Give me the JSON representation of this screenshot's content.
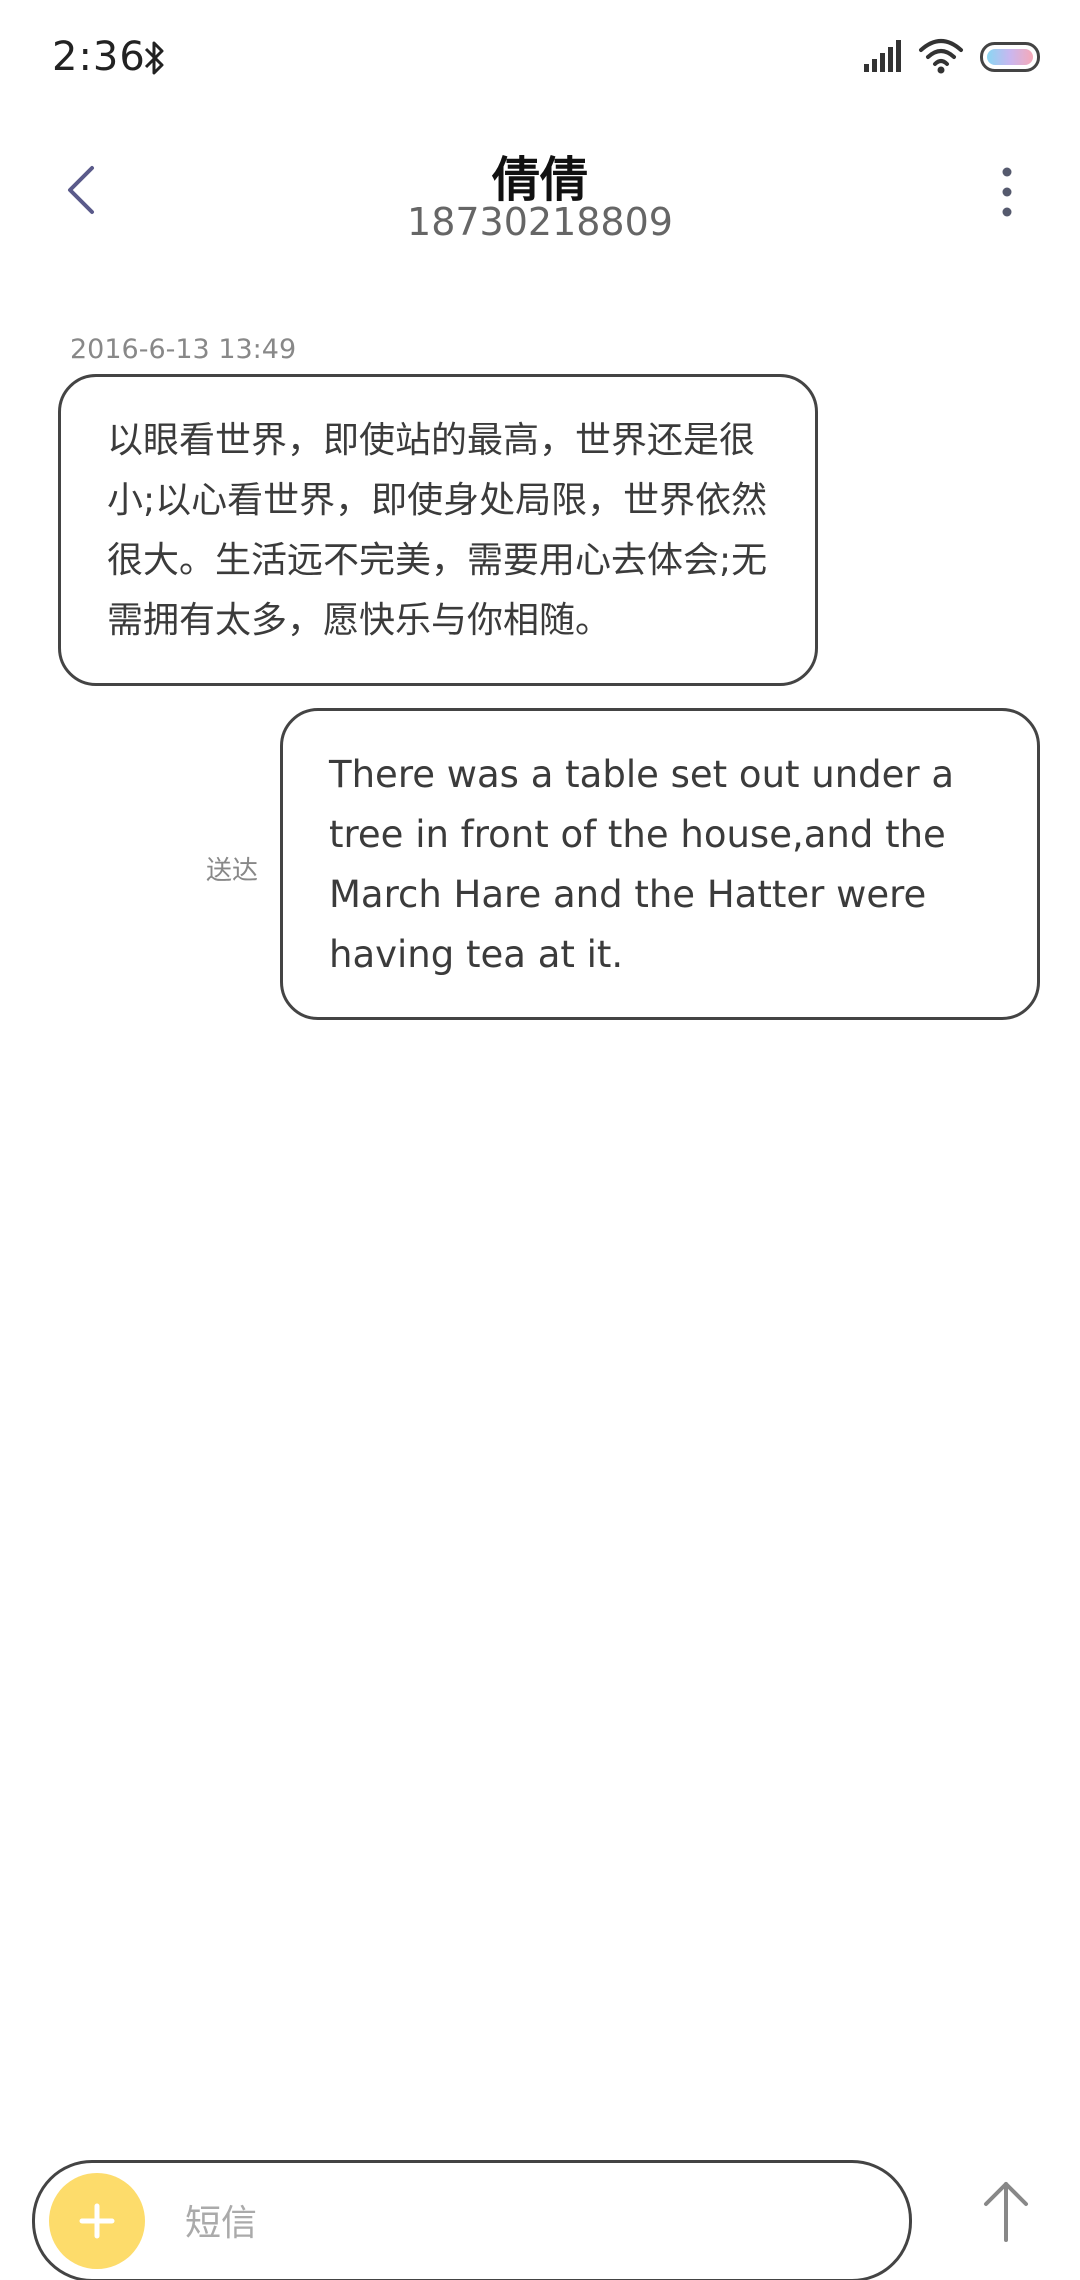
{
  "status_bar": {
    "time": "2:36",
    "icons": [
      "bluetooth-icon",
      "signal-icon",
      "wifi-icon",
      "battery-icon"
    ]
  },
  "header": {
    "contact_name": "倩倩",
    "phone_number": "18730218809",
    "back_icon": "chevron-left-icon",
    "more_icon": "more-vertical-icon"
  },
  "conversation": {
    "timestamp": "2016-6-13 13:49",
    "messages": [
      {
        "direction": "received",
        "text": "以眼看世界，即使站的最高，世界还是很小;以心看世界，即使身处局限，世界依然很大。生活远不完美，需要用心去体会;无需拥有太多，愿快乐与你相随。"
      },
      {
        "direction": "sent",
        "text": "There was a table set out under a tree in front of the house,and the March Hare and the Hatter were having tea at it.",
        "status": "送达"
      }
    ]
  },
  "composer": {
    "placeholder": "短信",
    "value": "",
    "attach_icon": "plus-icon",
    "send_icon": "arrow-up-icon"
  },
  "colors": {
    "accent_yellow": "#fddc6b",
    "bubble_border": "#444444",
    "back_chevron": "#5a5a8a"
  }
}
